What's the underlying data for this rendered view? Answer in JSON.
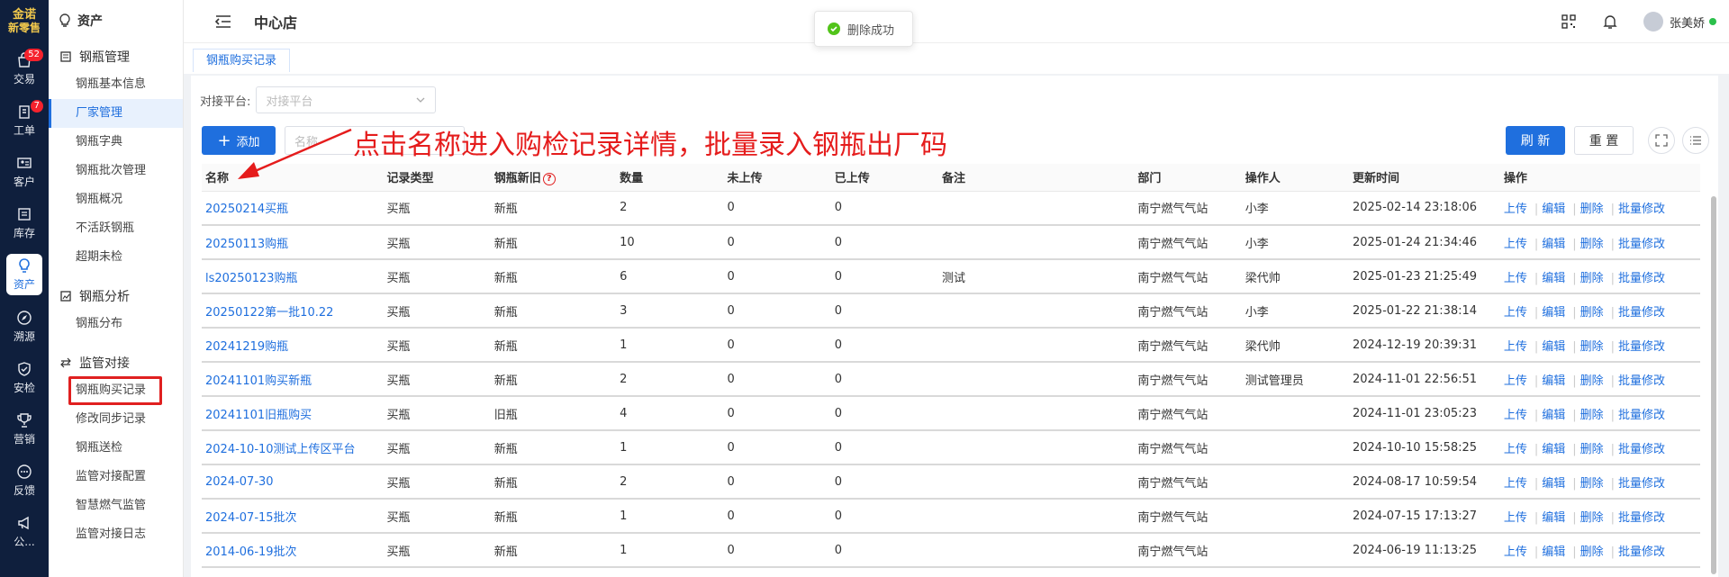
{
  "brand": {
    "line1": "金诺",
    "line2": "新零售"
  },
  "rail": [
    {
      "label": "交易",
      "icon": "bag-icon",
      "badge": "52"
    },
    {
      "label": "工单",
      "icon": "clipboard-icon",
      "badge": "7"
    },
    {
      "label": "客户",
      "icon": "contact-card-icon",
      "badge": ""
    },
    {
      "label": "库存",
      "icon": "inventory-icon",
      "badge": ""
    },
    {
      "label": "资产",
      "icon": "bulb-icon",
      "badge": "",
      "active": true
    },
    {
      "label": "溯源",
      "icon": "compass-icon",
      "badge": ""
    },
    {
      "label": "安检",
      "icon": "shield-icon",
      "badge": ""
    },
    {
      "label": "营销",
      "icon": "trophy-icon",
      "badge": ""
    },
    {
      "label": "反馈",
      "icon": "chat-icon",
      "badge": ""
    },
    {
      "label": "公...",
      "icon": "megaphone-icon",
      "badge": ""
    }
  ],
  "side": {
    "title": "资产",
    "groups": [
      {
        "title": "钢瓶管理",
        "items": [
          "钢瓶基本信息",
          "厂家管理",
          "钢瓶字典",
          "钢瓶批次管理",
          "钢瓶概况",
          "不活跃钢瓶",
          "超期未检"
        ]
      },
      {
        "title": "钢瓶分析",
        "items": [
          "钢瓶分布"
        ]
      },
      {
        "title": "监管对接",
        "items": [
          "钢瓶购买记录",
          "修改同步记录",
          "钢瓶送检",
          "监管对接配置",
          "智慧燃气监管",
          "监管对接日志"
        ]
      }
    ]
  },
  "header": {
    "store": "中心店",
    "user": "张美娇"
  },
  "toast": "删除成功",
  "tab": "钢瓶购买记录",
  "filter": {
    "label": "对接平台:",
    "placeholder": "对接平台"
  },
  "toolbar": {
    "add": "添加",
    "name_placeholder": "名称",
    "refresh": "刷 新",
    "reset": "重 置"
  },
  "annotation": "点击名称进入购检记录详情，批量录入钢瓶出厂码",
  "table": {
    "headers": [
      "名称",
      "记录类型",
      "钢瓶新旧",
      "数量",
      "未上传",
      "已上传",
      "备注",
      "部门",
      "操作人",
      "更新时间",
      "操作"
    ],
    "ops": [
      "上传",
      "编辑",
      "删除",
      "批量修改"
    ],
    "rows": [
      [
        "20250214买瓶",
        "买瓶",
        "新瓶",
        "2",
        "0",
        "0",
        "",
        "南宁燃气气站",
        "小李",
        "2025-02-14 23:18:06"
      ],
      [
        "20250113购瓶",
        "买瓶",
        "新瓶",
        "10",
        "0",
        "0",
        "",
        "南宁燃气气站",
        "小李",
        "2025-01-24 21:34:46"
      ],
      [
        "ls20250123购瓶",
        "买瓶",
        "新瓶",
        "6",
        "0",
        "0",
        "测试",
        "南宁燃气气站",
        "梁代帅",
        "2025-01-23 21:25:49"
      ],
      [
        "20250122第一批10.22",
        "买瓶",
        "新瓶",
        "3",
        "0",
        "0",
        "",
        "南宁燃气气站",
        "小李",
        "2025-01-22 21:38:14"
      ],
      [
        "20241219购瓶",
        "买瓶",
        "新瓶",
        "1",
        "0",
        "0",
        "",
        "南宁燃气气站",
        "梁代帅",
        "2024-12-19 20:39:31"
      ],
      [
        "20241101购买新瓶",
        "买瓶",
        "新瓶",
        "2",
        "0",
        "0",
        "",
        "南宁燃气气站",
        "测试管理员",
        "2024-11-01 22:56:51"
      ],
      [
        "20241101旧瓶购买",
        "买瓶",
        "旧瓶",
        "4",
        "0",
        "0",
        "",
        "南宁燃气气站",
        "",
        "2024-11-01 23:05:23"
      ],
      [
        "2024-10-10测试上传区平台",
        "买瓶",
        "新瓶",
        "1",
        "0",
        "0",
        "",
        "南宁燃气气站",
        "",
        "2024-10-10 15:58:25"
      ],
      [
        "2024-07-30",
        "买瓶",
        "新瓶",
        "2",
        "0",
        "0",
        "",
        "南宁燃气气站",
        "",
        "2024-08-17 10:59:54"
      ],
      [
        "2024-07-15批次",
        "买瓶",
        "新瓶",
        "1",
        "0",
        "0",
        "",
        "南宁燃气气站",
        "",
        "2024-07-15 17:13:27"
      ],
      [
        "2014-06-19批次",
        "买瓶",
        "新瓶",
        "1",
        "0",
        "0",
        "",
        "南宁燃气气站",
        "",
        "2024-06-19 11:13:25"
      ]
    ]
  }
}
